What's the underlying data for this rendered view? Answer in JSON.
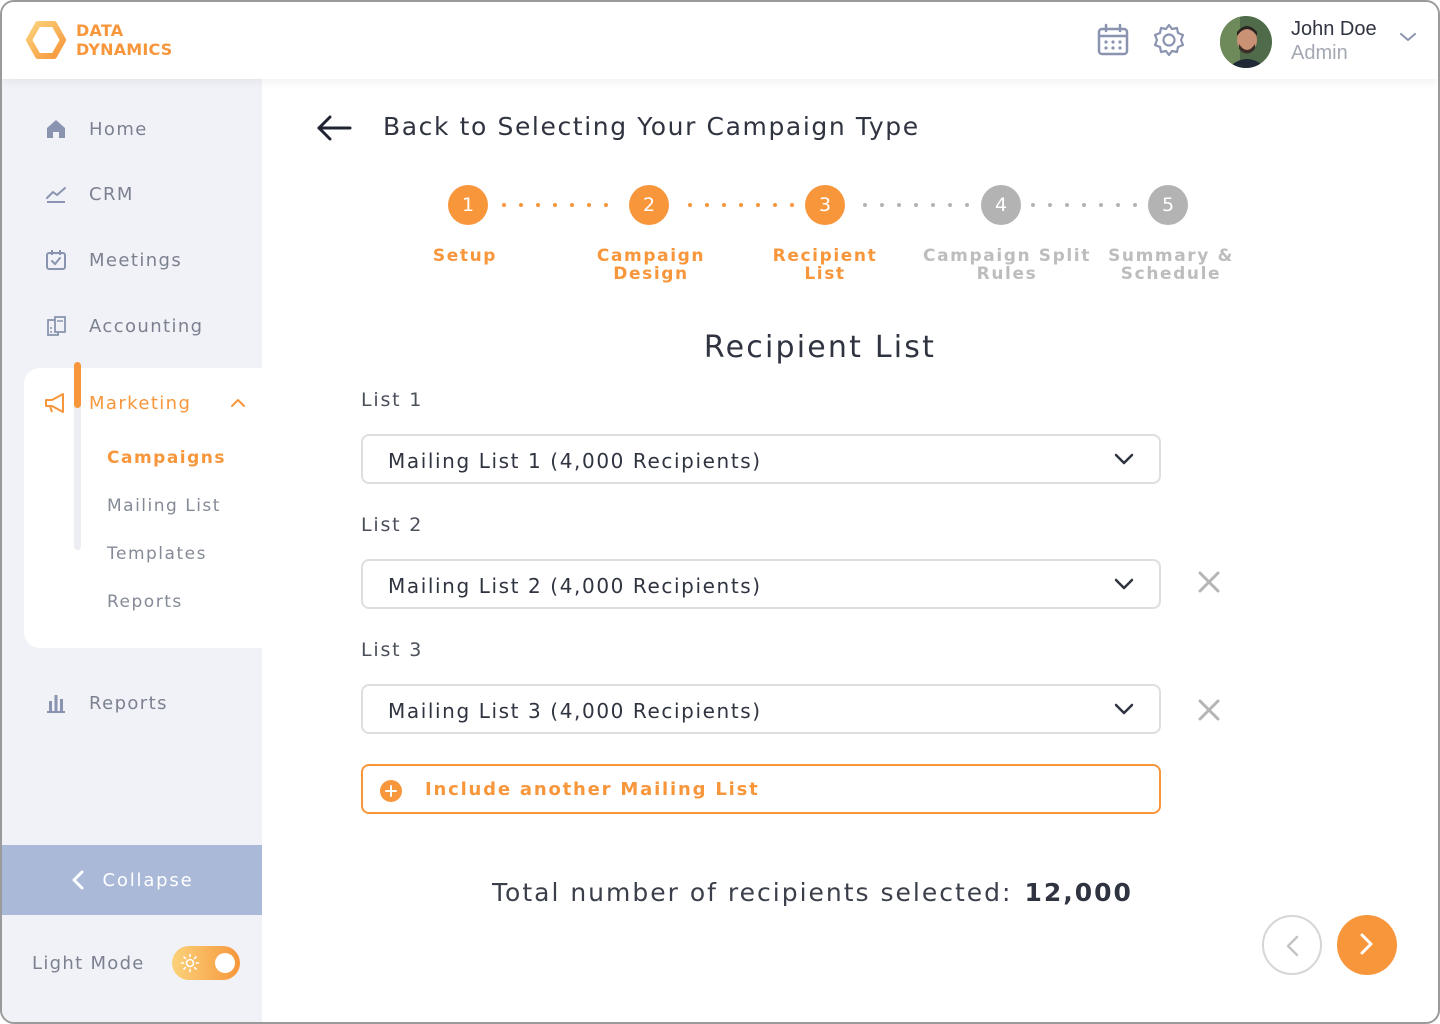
{
  "brand": {
    "line1": "DATA",
    "line2": "DYNAMICS",
    "color": "#f7963b"
  },
  "header": {
    "icons": [
      "calendar-icon",
      "settings-gear-icon"
    ],
    "user": {
      "name": "John Doe",
      "role": "Admin"
    }
  },
  "sidebar": {
    "items": [
      {
        "label": "Home",
        "icon": "home-icon"
      },
      {
        "label": "CRM",
        "icon": "trend-line-icon"
      },
      {
        "label": "Meetings",
        "icon": "calendar-check-icon"
      },
      {
        "label": "Accounting",
        "icon": "calculator-icon"
      },
      {
        "label": "Marketing",
        "icon": "megaphone-icon",
        "expanded": true
      },
      {
        "label": "Reports",
        "icon": "bar-chart-icon"
      }
    ],
    "marketing_sub": [
      {
        "label": "Campaigns",
        "active": true
      },
      {
        "label": "Mailing List"
      },
      {
        "label": "Templates"
      },
      {
        "label": "Reports"
      }
    ],
    "collapse_label": "Collapse",
    "light_mode_label": "Light Mode",
    "light_mode_on": true
  },
  "main": {
    "back_label": "Back to Selecting Your Campaign Type",
    "steps": [
      {
        "number": "1",
        "line1": "Setup",
        "line2": "",
        "done": true
      },
      {
        "number": "2",
        "line1": "Campaign",
        "line2": "Design",
        "done": true
      },
      {
        "number": "3",
        "line1": "Recipient",
        "line2": "List",
        "done": true
      },
      {
        "number": "4",
        "line1": "Campaign Split",
        "line2": "Rules",
        "done": false
      },
      {
        "number": "5",
        "line1": "Summary &",
        "line2": "Schedule",
        "done": false
      }
    ],
    "section_title": "Recipient List",
    "lists": [
      {
        "label": "List 1",
        "value": "Mailing List 1 (4,000 Recipients)",
        "removable": false
      },
      {
        "label": "List 2",
        "value": "Mailing List 2 (4,000 Recipients)",
        "removable": true
      },
      {
        "label": "List 3",
        "value": "Mailing List 3 (4,000 Recipients)",
        "removable": true
      }
    ],
    "include_label": "Include another Mailing List",
    "total_label": "Total number of recipients selected:",
    "total_value": "12,000"
  }
}
